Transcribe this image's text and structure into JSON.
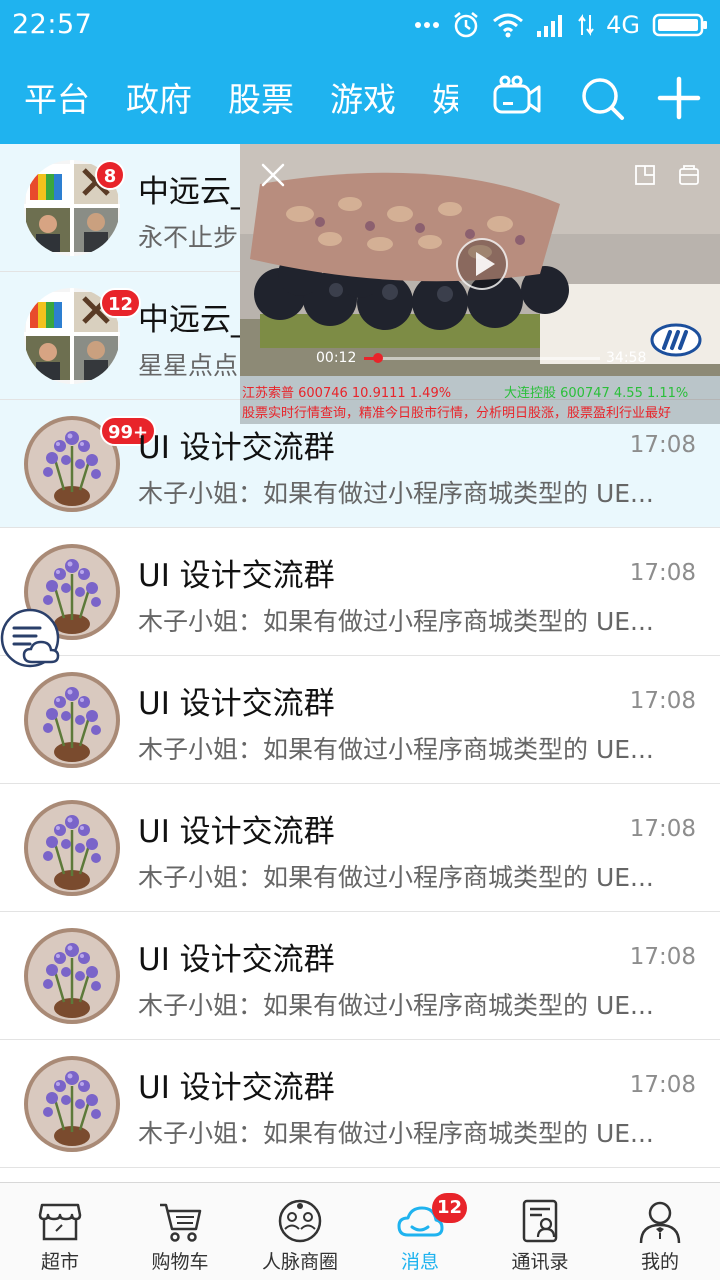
{
  "status_bar": {
    "time": "22:57",
    "network": "4G",
    "icons": [
      "more-dots-icon",
      "alarm-icon",
      "wifi-icon",
      "signal-icon",
      "data-arrows-icon",
      "battery-icon"
    ]
  },
  "top_nav": {
    "tabs": [
      "平台",
      "政府",
      "股票",
      "游戏",
      "娱乐"
    ],
    "icons": [
      "video-camera-icon",
      "search-icon",
      "plus-icon"
    ]
  },
  "chats": [
    {
      "name": "中远云_",
      "preview": "永不止步",
      "time": "",
      "badge": "8",
      "pinned": true,
      "avatar": "group-collage"
    },
    {
      "name": "中远云_",
      "preview": "星星点点",
      "time": "",
      "badge": "12",
      "pinned": true,
      "avatar": "group-collage"
    },
    {
      "name": "UI 设计交流群",
      "preview": "木子小姐：如果有做过小程序商城类型的 UE...",
      "time": "17:08",
      "badge": "99+",
      "pinned": true,
      "avatar": "orchid"
    },
    {
      "name": "UI 设计交流群",
      "preview": "木子小姐：如果有做过小程序商城类型的 UE...",
      "time": "17:08",
      "badge": "",
      "pinned": false,
      "avatar": "orchid"
    },
    {
      "name": "UI 设计交流群",
      "preview": "木子小姐：如果有做过小程序商城类型的 UE...",
      "time": "17:08",
      "badge": "",
      "pinned": false,
      "avatar": "orchid"
    },
    {
      "name": "UI 设计交流群",
      "preview": "木子小姐：如果有做过小程序商城类型的 UE...",
      "time": "17:08",
      "badge": "",
      "pinned": false,
      "avatar": "orchid"
    },
    {
      "name": "UI 设计交流群",
      "preview": "木子小姐：如果有做过小程序商城类型的 UE...",
      "time": "17:08",
      "badge": "",
      "pinned": false,
      "avatar": "orchid"
    },
    {
      "name": "UI 设计交流群",
      "preview": "木子小姐：如果有做过小程序商城类型的 UE...",
      "time": "17:08",
      "badge": "",
      "pinned": false,
      "avatar": "orchid"
    }
  ],
  "video_player": {
    "current_time": "00:12",
    "duration": "34:58",
    "progress": 0.06,
    "controls": [
      "close-icon",
      "restore-window-icon",
      "minimize-window-icon",
      "play-icon"
    ]
  },
  "ticker": {
    "stock1": "江苏索普  600746  10.9111  1.49%",
    "stock2": "大连控股  600747  4.55  1.11%",
    "headline": "股票实时行情查询，精准今日股市行情，分析明日股涨，股票盈利行业最好"
  },
  "tab_bar": {
    "tabs": [
      {
        "label": "超市",
        "icon": "store-icon"
      },
      {
        "label": "购物车",
        "icon": "cart-icon"
      },
      {
        "label": "人脉商圈",
        "icon": "network-icon"
      },
      {
        "label": "消息",
        "icon": "message-cloud-icon",
        "badge": "12",
        "active": true
      },
      {
        "label": "通讯录",
        "icon": "contacts-icon"
      },
      {
        "label": "我的",
        "icon": "profile-icon"
      }
    ]
  },
  "colors": {
    "primary": "#1fb3ef",
    "badge": "#e8242a",
    "pinned_bg": "#eaf8fd",
    "stock_up": "#2bbf3a"
  }
}
